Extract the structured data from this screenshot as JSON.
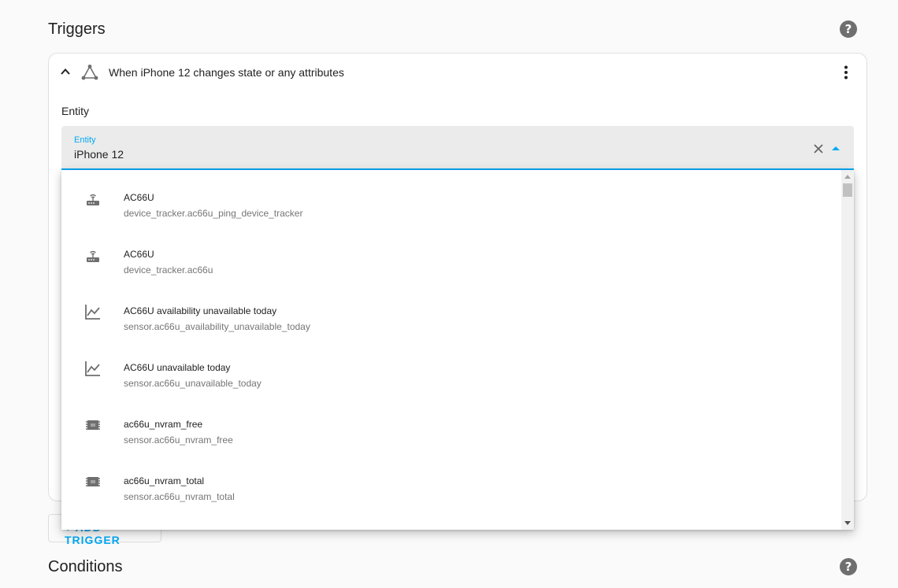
{
  "triggers": {
    "title": "Triggers",
    "card_title": "When iPhone 12 changes state or any attributes",
    "entity_label": "Entity",
    "field": {
      "floating_label": "Entity",
      "value": "iPhone 12"
    },
    "add_button": "+ ADD TRIGGER"
  },
  "dropdown": {
    "items": [
      {
        "name": "AC66U",
        "entity_id": "device_tracker.ac66u_ping_device_tracker",
        "icon": "router-wireless-icon"
      },
      {
        "name": "AC66U",
        "entity_id": "device_tracker.ac66u",
        "icon": "router-wireless-icon"
      },
      {
        "name": "AC66U availability unavailable today",
        "entity_id": "sensor.ac66u_availability_unavailable_today",
        "icon": "chart-line-icon"
      },
      {
        "name": "AC66U unavailable today",
        "entity_id": "sensor.ac66u_unavailable_today",
        "icon": "chart-line-icon"
      },
      {
        "name": "ac66u_nvram_free",
        "entity_id": "sensor.ac66u_nvram_free",
        "icon": "memory-chip-icon"
      },
      {
        "name": "ac66u_nvram_total",
        "entity_id": "sensor.ac66u_nvram_total",
        "icon": "memory-chip-icon"
      }
    ]
  },
  "conditions": {
    "title": "Conditions"
  },
  "colors": {
    "accent": "#03a9f4",
    "icon": "#6f6f6f",
    "field_bg": "#ebebeb"
  }
}
